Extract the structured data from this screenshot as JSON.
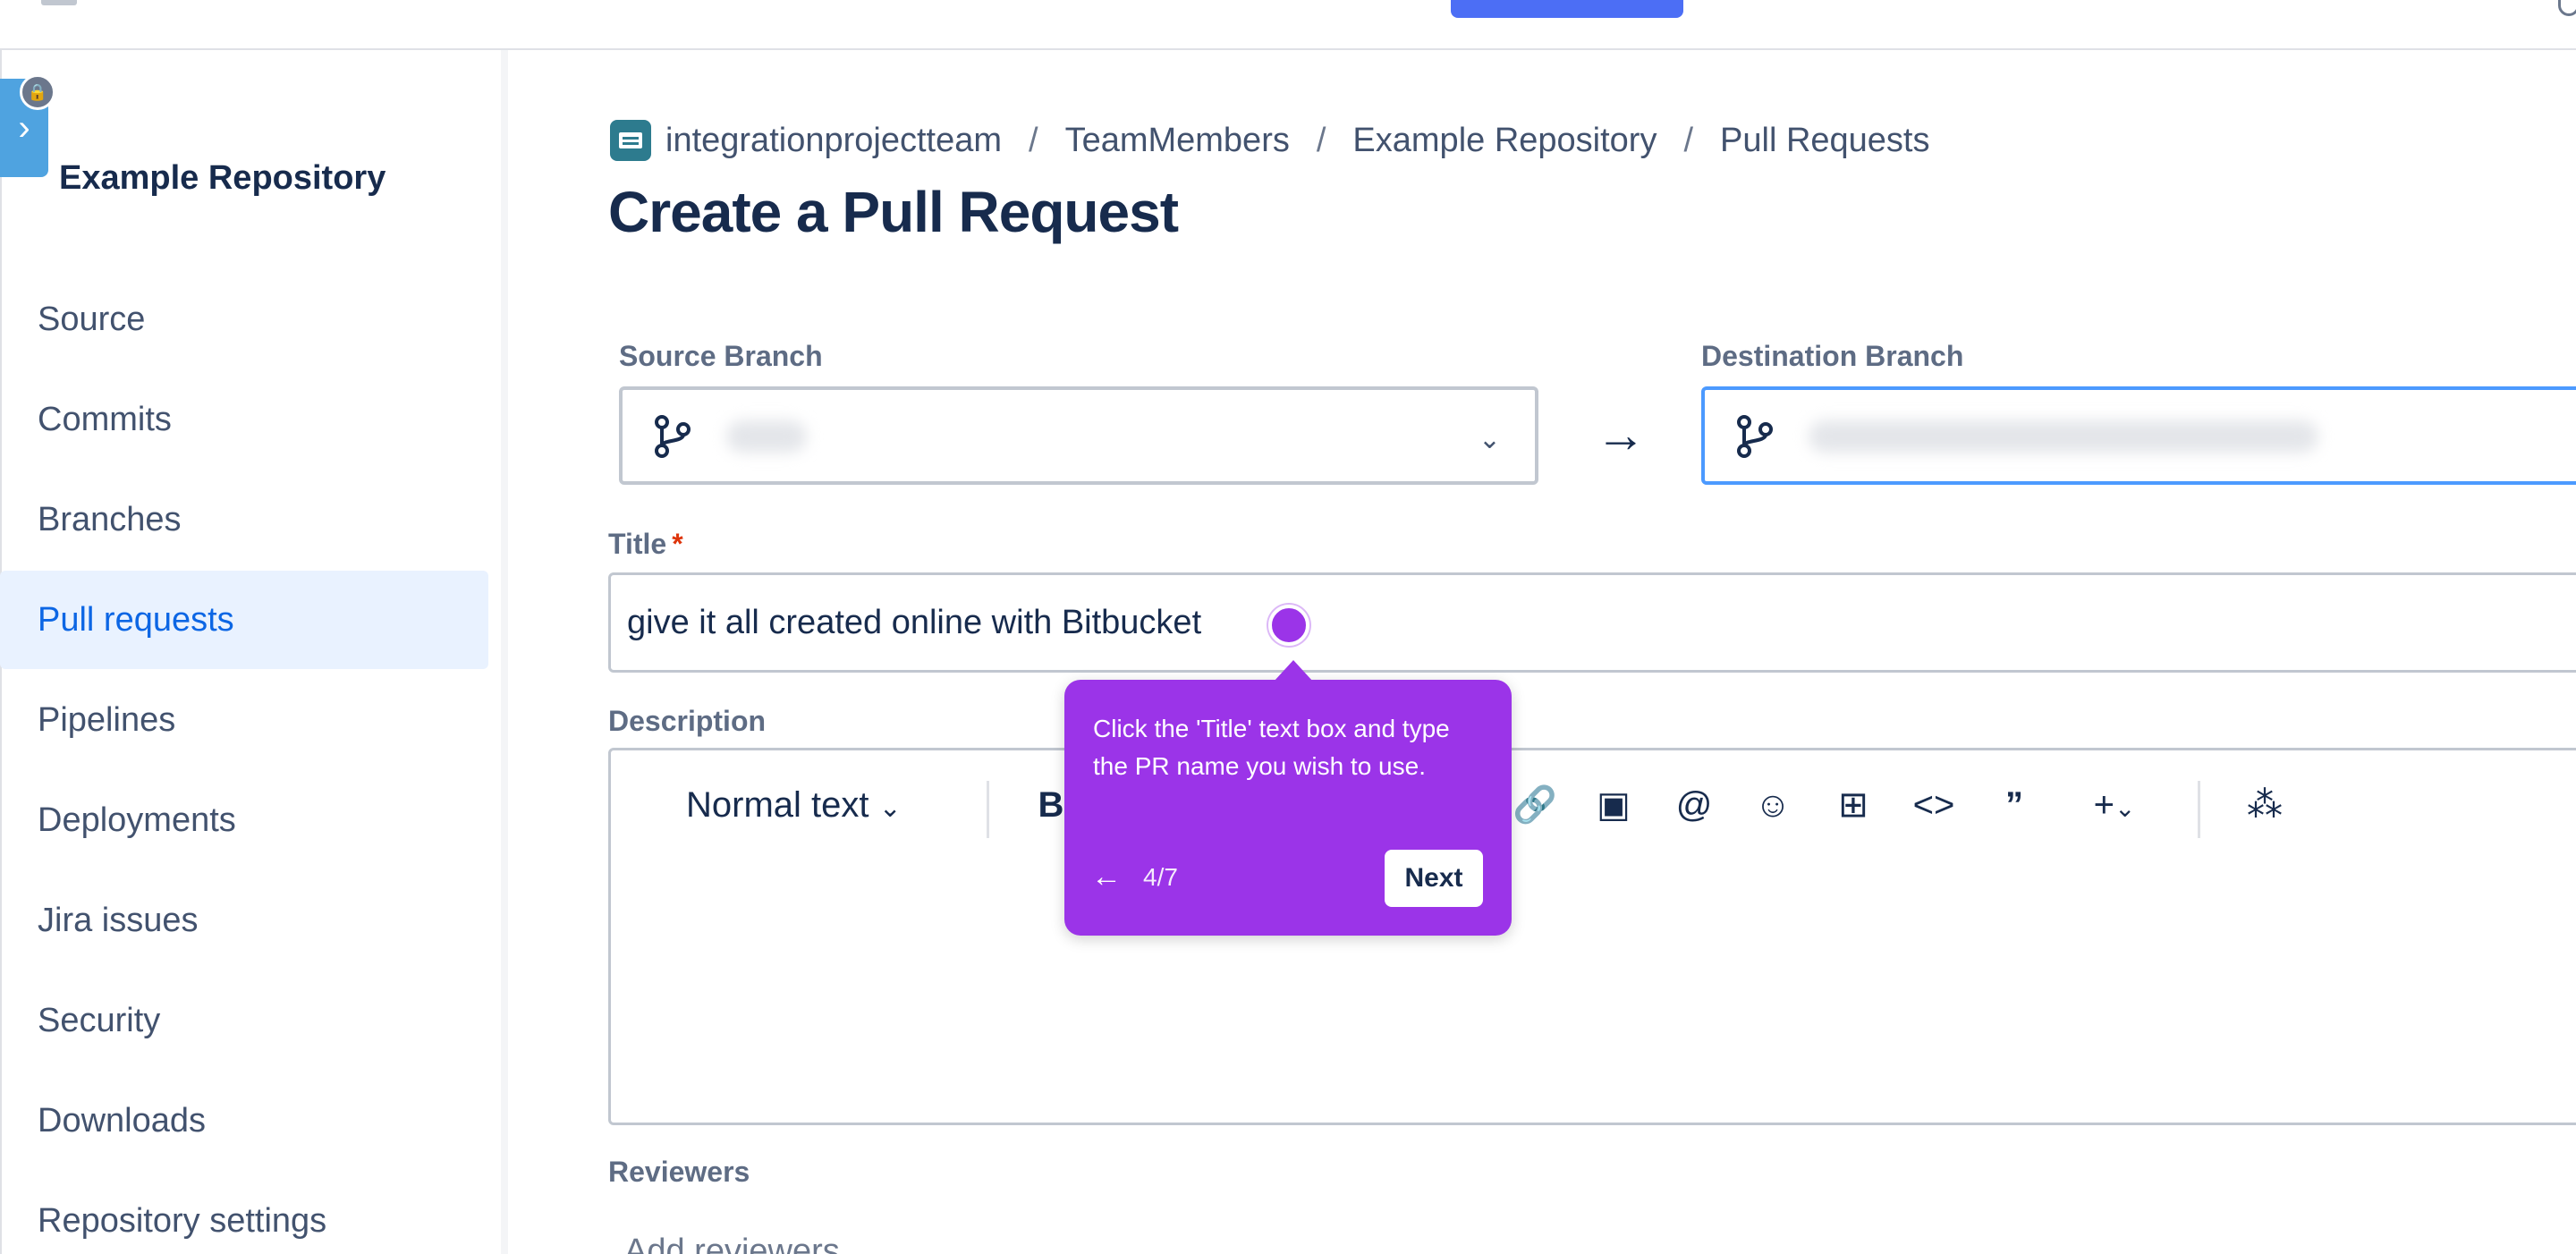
{
  "sidebar": {
    "repo_name": "Example Repository",
    "items": [
      {
        "label": "Source"
      },
      {
        "label": "Commits"
      },
      {
        "label": "Branches"
      },
      {
        "label": "Pull requests",
        "active": true
      },
      {
        "label": "Pipelines"
      },
      {
        "label": "Deployments"
      },
      {
        "label": "Jira issues"
      },
      {
        "label": "Security"
      },
      {
        "label": "Downloads"
      },
      {
        "label": "Repository settings"
      }
    ]
  },
  "breadcrumb": [
    "integrationprojectteam",
    "TeamMembers",
    "Example Repository",
    "Pull Requests"
  ],
  "breadcrumb_separator": "/",
  "page_title": "Create a Pull Request",
  "form": {
    "source_label": "Source Branch",
    "destination_label": "Destination Branch",
    "title_label": "Title",
    "required_mark": "*",
    "title_value": "give it all created online with Bitbucket",
    "description_label": "Description",
    "reviewers_label": "Reviewers",
    "reviewers_placeholder": "Add reviewers"
  },
  "editor_toolbar": {
    "text_style": "Normal text",
    "bold": "B",
    "icons": [
      "link-icon",
      "image-icon",
      "mention-icon",
      "emoji-icon",
      "table-icon",
      "code-icon",
      "quote-icon",
      "insert-plus-icon",
      "ai-sparkle-icon"
    ]
  },
  "tooltip": {
    "text": "Click the 'Title' text box and type the PR name you wish to use.",
    "step": "4/7",
    "next_label": "Next"
  },
  "colors": {
    "accent": "#0C66E4",
    "tooltip": "#9B34E8",
    "active_nav_bg": "#E9F2FF"
  }
}
